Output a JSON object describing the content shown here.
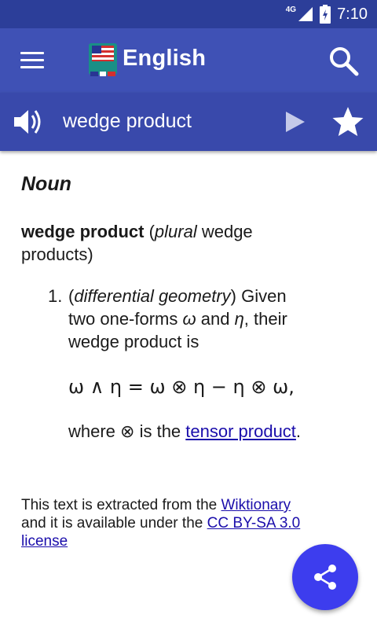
{
  "status_bar": {
    "network": "4G",
    "time": "7:10"
  },
  "app_bar": {
    "title": "English",
    "colors": {
      "primary": "#3f51b5",
      "primary_dark": "#2c3e99"
    }
  },
  "word_bar": {
    "word": "wedge product"
  },
  "entry": {
    "part_of_speech": "Noun",
    "headword": "wedge product",
    "plural_open": " (",
    "plural_label": "plural",
    "plural_form": " wedge products)",
    "sense_number": "1.",
    "sense_context_open": "(",
    "sense_context": "differential geometry",
    "sense_context_close": ")",
    "sense_text_1": " Given two one-forms ",
    "omega": "ω",
    "and": " and ",
    "eta": "η",
    "sense_text_2": ", their wedge product is",
    "formula": "ω ∧ η = ω ⊗ η − η ⊗ ω,",
    "where_prefix": "where ⊗ is the ",
    "where_link": "tensor product",
    "where_suffix": "."
  },
  "footer": {
    "text_1": "This text is extracted from the ",
    "link_1": "Wiktionary",
    "text_2": " and it is available under the ",
    "link_2": "CC BY-SA 3.0 license"
  },
  "icons": [
    "menu-icon",
    "dictionary-logo-icon",
    "search-icon",
    "speaker-icon",
    "play-icon",
    "star-icon",
    "share-icon",
    "battery-icon",
    "signal-icon"
  ]
}
